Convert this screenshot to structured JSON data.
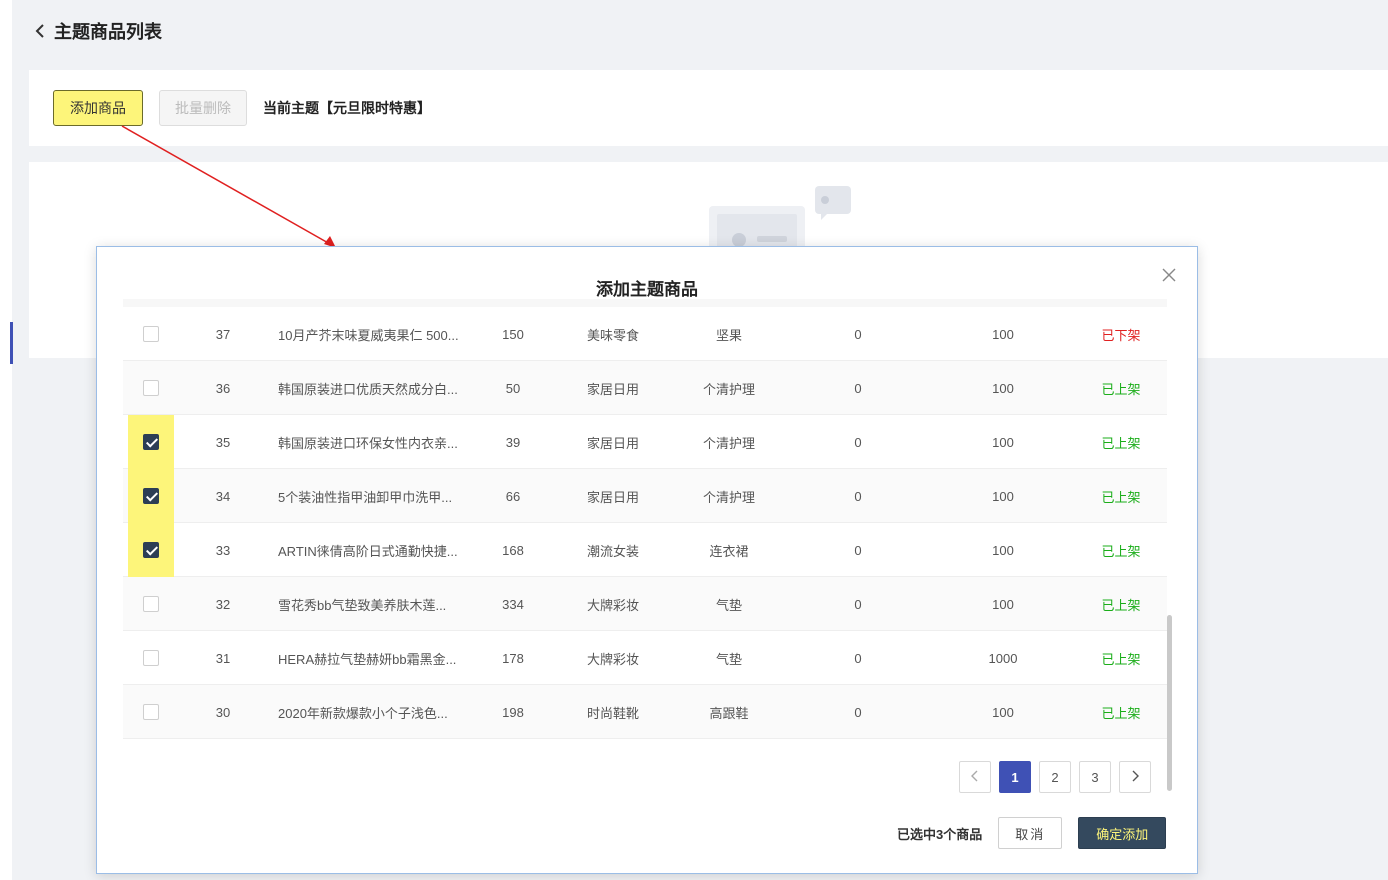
{
  "header": {
    "title": "主题商品列表",
    "back_icon": "chevron-left-icon"
  },
  "toolbar": {
    "add_label": "添加商品",
    "batch_delete_label": "批量删除",
    "theme_text": "当前主题【元旦限时特惠】"
  },
  "modal": {
    "title": "添加主题商品",
    "close_icon": "close-icon",
    "rows": [
      {
        "checked": false,
        "id": "37",
        "name": "10月产芥末味夏威夷果仁 500...",
        "price": "150",
        "cat1": "美味零食",
        "cat2": "坚果",
        "sold": "0",
        "stock": "100",
        "status": "已下架",
        "status_type": "off"
      },
      {
        "checked": false,
        "id": "36",
        "name": "韩国原装进口优质天然成分白...",
        "price": "50",
        "cat1": "家居日用",
        "cat2": "个清护理",
        "sold": "0",
        "stock": "100",
        "status": "已上架",
        "status_type": "on"
      },
      {
        "checked": true,
        "id": "35",
        "name": "韩国原装进口环保女性内衣亲...",
        "price": "39",
        "cat1": "家居日用",
        "cat2": "个清护理",
        "sold": "0",
        "stock": "100",
        "status": "已上架",
        "status_type": "on"
      },
      {
        "checked": true,
        "id": "34",
        "name": "5个装油性指甲油卸甲巾洗甲...",
        "price": "66",
        "cat1": "家居日用",
        "cat2": "个清护理",
        "sold": "0",
        "stock": "100",
        "status": "已上架",
        "status_type": "on"
      },
      {
        "checked": true,
        "id": "33",
        "name": "ARTIN徕倩高阶日式通勤快捷...",
        "price": "168",
        "cat1": "潮流女装",
        "cat2": "连衣裙",
        "sold": "0",
        "stock": "100",
        "status": "已上架",
        "status_type": "on"
      },
      {
        "checked": false,
        "id": "32",
        "name": "雪花秀bb气垫致美养肤木莲...",
        "price": "334",
        "cat1": "大牌彩妆",
        "cat2": "气垫",
        "sold": "0",
        "stock": "100",
        "status": "已上架",
        "status_type": "on"
      },
      {
        "checked": false,
        "id": "31",
        "name": "HERA赫拉气垫赫妍bb霜黑金...",
        "price": "178",
        "cat1": "大牌彩妆",
        "cat2": "气垫",
        "sold": "0",
        "stock": "1000",
        "status": "已上架",
        "status_type": "on"
      },
      {
        "checked": false,
        "id": "30",
        "name": "2020年新款爆款小个子浅色...",
        "price": "198",
        "cat1": "时尚鞋靴",
        "cat2": "高跟鞋",
        "sold": "0",
        "stock": "100",
        "status": "已上架",
        "status_type": "on"
      }
    ],
    "pagination": {
      "prev_icon": "chevron-left-icon",
      "next_icon": "chevron-right-icon",
      "pages": [
        "1",
        "2",
        "3"
      ],
      "current": "1"
    },
    "footer": {
      "selected_text": "已选中3个商品",
      "cancel_label": "取消",
      "confirm_label": "确定添加"
    }
  },
  "colors": {
    "accent": "#3f51b5",
    "highlight": "#fdf57a",
    "on": "#1aad19",
    "off": "#e02020",
    "confirm_bg": "#34495e"
  }
}
